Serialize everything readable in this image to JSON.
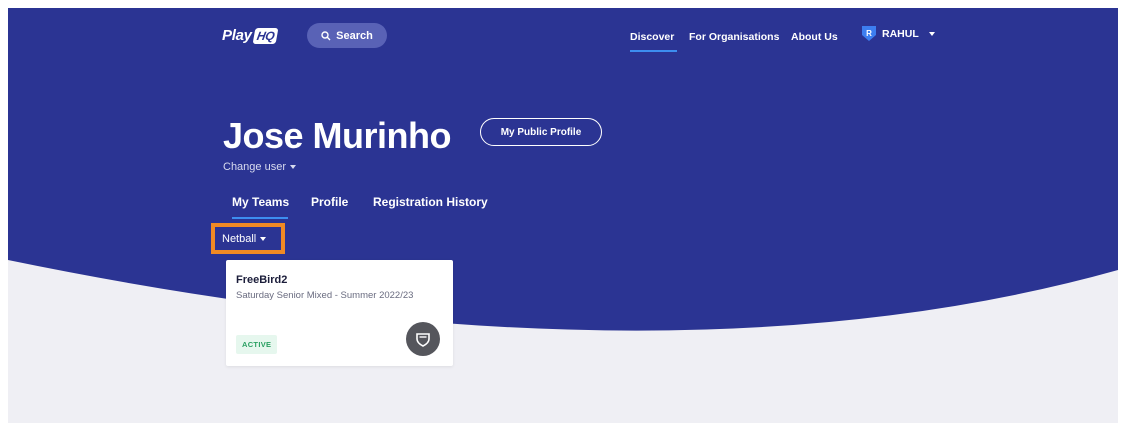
{
  "brand": {
    "name": "Play",
    "badge": "HQ",
    "primary": "#2b3493",
    "accent": "#3d8ef0",
    "highlight": "#f08a24"
  },
  "header": {
    "search_label": "Search",
    "nav": [
      "Discover",
      "For Organisations",
      "About Us"
    ],
    "active_nav": "Discover",
    "user": {
      "initial": "R",
      "name": "RAHUL"
    }
  },
  "profile": {
    "name": "Jose Murinho",
    "public_profile_label": "My Public Profile",
    "change_user_label": "Change user"
  },
  "tabs": [
    "My Teams",
    "Profile",
    "Registration History"
  ],
  "active_tab": "My Teams",
  "sport_filter": {
    "selected": "Netball"
  },
  "teams": [
    {
      "name": "FreeBird2",
      "competition": "Saturday Senior Mixed - Summer 2022/23",
      "status": "ACTIVE",
      "icon": "team-shield-icon"
    }
  ]
}
